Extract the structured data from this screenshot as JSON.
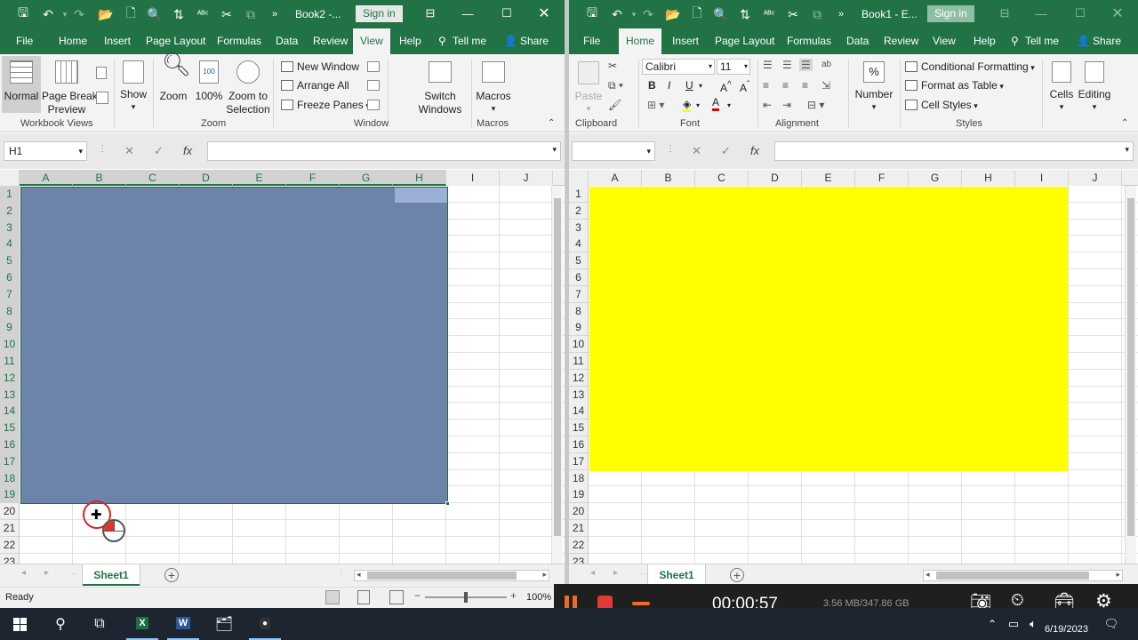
{
  "left": {
    "title": "Book2 -...",
    "sign_in": "Sign in",
    "tabs": [
      "File",
      "Home",
      "Insert",
      "Page Layout",
      "Formulas",
      "Data",
      "Review",
      "View",
      "Help",
      "Tell me",
      "Share"
    ],
    "active_tab": "View",
    "ribbon": {
      "normal": "Normal",
      "page_break_1": "Page Break",
      "page_break_2": "Preview",
      "show": "Show",
      "zoom": "Zoom",
      "zoom100": "100%",
      "zoom_sel_1": "Zoom to",
      "zoom_sel_2": "Selection",
      "new_window": "New Window",
      "arrange_all": "Arrange All",
      "freeze_panes": "Freeze Panes",
      "switch_1": "Switch",
      "switch_2": "Windows",
      "macros": "Macros",
      "grp_workbook_views": "Workbook Views",
      "grp_zoom": "Zoom",
      "grp_window": "Window",
      "grp_macros": "Macros"
    },
    "name_box": "H1",
    "columns": [
      "A",
      "B",
      "C",
      "D",
      "E",
      "F",
      "G",
      "H",
      "I",
      "J"
    ],
    "rows": [
      "1",
      "2",
      "3",
      "4",
      "5",
      "6",
      "7",
      "8",
      "9",
      "10",
      "11",
      "12",
      "13",
      "14",
      "15",
      "16",
      "17",
      "18",
      "19",
      "20",
      "21",
      "22",
      "23"
    ],
    "sheet_tab": "Sheet1",
    "status": "Ready",
    "zoom_level": "100%",
    "selection_color": "#6d84aa"
  },
  "right": {
    "title": "Book1 - E...",
    "sign_in": "Sign in",
    "tabs": [
      "File",
      "Home",
      "Insert",
      "Page Layout",
      "Formulas",
      "Data",
      "Review",
      "View",
      "Help",
      "Tell me",
      "Share"
    ],
    "active_tab": "Home",
    "ribbon": {
      "paste": "Paste",
      "font_name": "Calibri",
      "font_size": "11",
      "number": "Number",
      "conditional_formatting": "Conditional Formatting",
      "format_as_table": "Format as Table",
      "cell_styles": "Cell Styles",
      "cells": "Cells",
      "editing": "Editing",
      "grp_clipboard": "Clipboard",
      "grp_font": "Font",
      "grp_alignment": "Alignment",
      "grp_styles": "Styles"
    },
    "columns": [
      "A",
      "B",
      "C",
      "D",
      "E",
      "F",
      "G",
      "H",
      "I",
      "J"
    ],
    "rows": [
      "1",
      "2",
      "3",
      "4",
      "5",
      "6",
      "7",
      "8",
      "9",
      "10",
      "11",
      "12",
      "13",
      "14",
      "15",
      "16",
      "17",
      "18",
      "19",
      "20",
      "21",
      "22",
      "23"
    ],
    "sheet_tab": "Sheet1",
    "fill_color": "#ffff00"
  },
  "recorder": {
    "time": "00:00:57",
    "size": "3.56 MB/347.86 GB"
  },
  "taskbar": {
    "date": "6/19/2023"
  }
}
